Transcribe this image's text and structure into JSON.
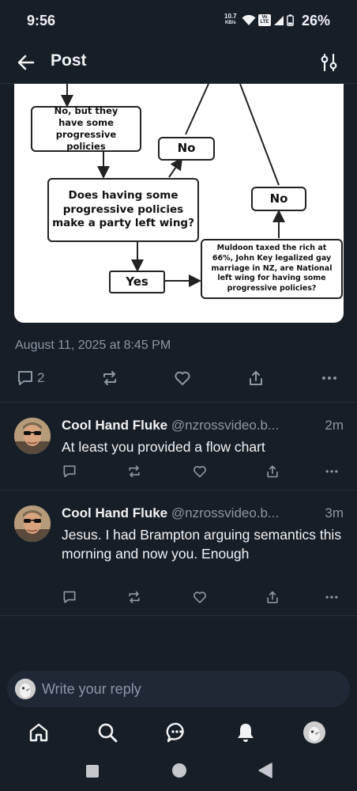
{
  "status_bar": {
    "time": "9:56",
    "net_speed": "10.7",
    "net_unit": "KB/s",
    "volte": "Vo LTE",
    "battery": "26%"
  },
  "header": {
    "title": "Post",
    "back_icon": "arrow-left-icon",
    "filter_icon": "sliders-icon"
  },
  "flowchart": {
    "box1": "No, but they have some progressive policies",
    "box2": "No",
    "box3": "Does having some progressive policies make a party left wing?",
    "box4": "No",
    "box5": "Yes",
    "box6": "Muldoon taxed the rich at 66%, John Key legalized gay marriage in NZ, are National left wing for having some progressive policies?"
  },
  "post": {
    "date": "August 11, 2025 at 8:45 PM",
    "reply_count": "2"
  },
  "replies": [
    {
      "name": "Cool Hand Fluke",
      "handle": "@nzrossvideo.b...",
      "time": "2m",
      "text": "At least you provided a flow chart"
    },
    {
      "name": "Cool Hand Fluke",
      "handle": "@nzrossvideo.b...",
      "time": "3m",
      "text": "Jesus. I had Brampton arguing semantics this morning and now you. Enough"
    }
  ],
  "composer": {
    "placeholder": "Write your reply"
  },
  "tabs": [
    "home-icon",
    "search-icon",
    "chat-icon",
    "notifications-icon",
    "profile-avatar"
  ],
  "colors": {
    "background": "#161e27",
    "muted": "#8b98a5",
    "divider": "#25303c"
  }
}
